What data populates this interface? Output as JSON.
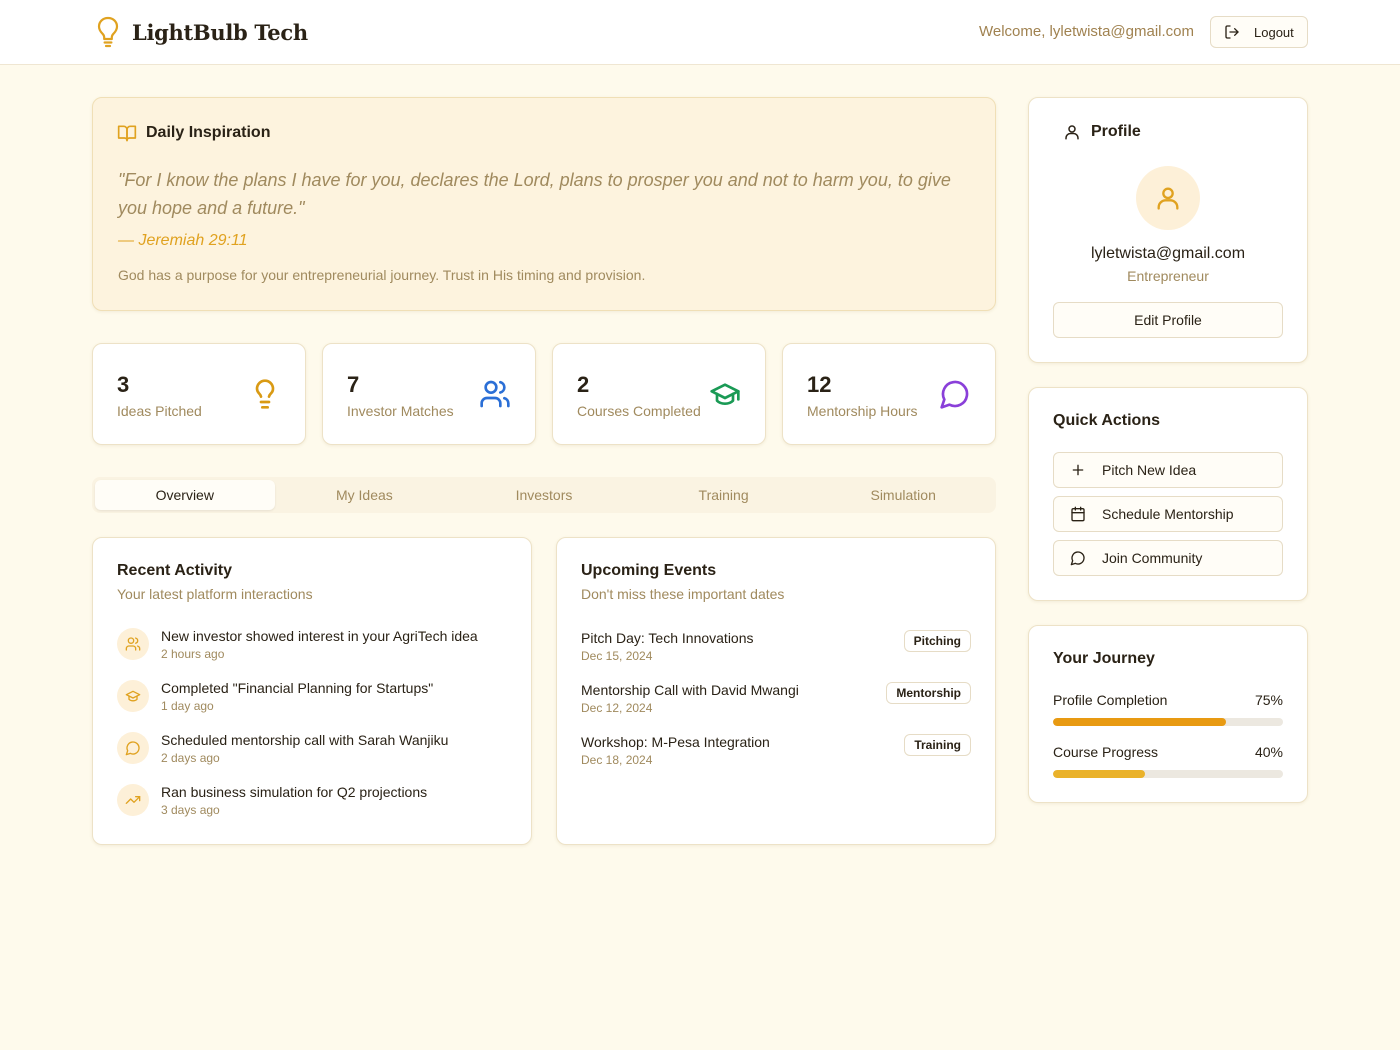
{
  "header": {
    "brand": "LightBulb Tech",
    "welcome": "Welcome, lyletwista@gmail.com",
    "logout_label": "Logout"
  },
  "inspiration": {
    "title": "Daily Inspiration",
    "quote": "\"For I know the plans I have for you, declares the Lord, plans to prosper you and not to harm you, to give you hope and a future.\"",
    "reference": "— Jeremiah 29:11",
    "note": "God has a purpose for your entrepreneurial journey. Trust in His timing and provision."
  },
  "stats": [
    {
      "value": "3",
      "label": "Ideas Pitched",
      "icon": "lightbulb-icon",
      "color": "#d99a14"
    },
    {
      "value": "7",
      "label": "Investor Matches",
      "icon": "users-icon",
      "color": "#2b6fd6"
    },
    {
      "value": "2",
      "label": "Courses Completed",
      "icon": "graduation-cap-icon",
      "color": "#1a9a55"
    },
    {
      "value": "12",
      "label": "Mentorship Hours",
      "icon": "message-circle-icon",
      "color": "#8a3fd9"
    }
  ],
  "tabs": [
    {
      "label": "Overview",
      "active": true
    },
    {
      "label": "My Ideas",
      "active": false
    },
    {
      "label": "Investors",
      "active": false
    },
    {
      "label": "Training",
      "active": false
    },
    {
      "label": "Simulation",
      "active": false
    }
  ],
  "activity": {
    "title": "Recent Activity",
    "subtitle": "Your latest platform interactions",
    "items": [
      {
        "title": "New investor showed interest in your AgriTech idea",
        "time": "2 hours ago",
        "icon": "users-icon"
      },
      {
        "title": "Completed \"Financial Planning for Startups\"",
        "time": "1 day ago",
        "icon": "graduation-cap-icon"
      },
      {
        "title": "Scheduled mentorship call with Sarah Wanjiku",
        "time": "2 days ago",
        "icon": "message-circle-icon"
      },
      {
        "title": "Ran business simulation for Q2 projections",
        "time": "3 days ago",
        "icon": "trending-up-icon"
      }
    ]
  },
  "events": {
    "title": "Upcoming Events",
    "subtitle": "Don't miss these important dates",
    "items": [
      {
        "title": "Pitch Day: Tech Innovations",
        "date": "Dec 15, 2024",
        "badge": "Pitching"
      },
      {
        "title": "Mentorship Call with David Mwangi",
        "date": "Dec 12, 2024",
        "badge": "Mentorship"
      },
      {
        "title": "Workshop: M-Pesa Integration",
        "date": "Dec 18, 2024",
        "badge": "Training"
      }
    ]
  },
  "profile": {
    "title": "Profile",
    "email": "lyletwista@gmail.com",
    "role": "Entrepreneur",
    "edit_label": "Edit Profile"
  },
  "quick_actions": {
    "title": "Quick Actions",
    "items": [
      {
        "label": "Pitch New Idea",
        "icon": "plus-icon"
      },
      {
        "label": "Schedule Mentorship",
        "icon": "calendar-icon"
      },
      {
        "label": "Join Community",
        "icon": "message-circle-icon"
      }
    ]
  },
  "journey": {
    "title": "Your Journey",
    "items": [
      {
        "label": "Profile Completion",
        "percent_label": "75%",
        "percent": 75,
        "color": "#e89a12"
      },
      {
        "label": "Course Progress",
        "percent_label": "40%",
        "percent": 40,
        "color": "#eab22a"
      }
    ]
  },
  "colors": {
    "accent": "#e0a220",
    "background": "#fefaec",
    "muted_text": "#a08a5e"
  }
}
